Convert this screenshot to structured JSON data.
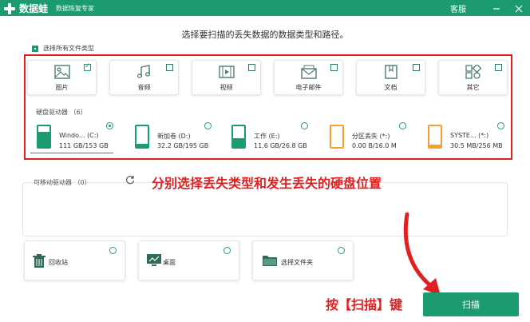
{
  "titlebar": {
    "brand": "数据蛙",
    "subtitle": "数据恢复专家",
    "service": "客服",
    "minimize_icon": "minimize-icon",
    "close_icon": "close-icon"
  },
  "heading": "选择要扫描的丢失数据的数据类型和路径。",
  "select_all_label": "选择所有文件类型",
  "file_types": [
    {
      "label": "图片",
      "icon": "image-icon",
      "checked": true
    },
    {
      "label": "音频",
      "icon": "audio-icon",
      "checked": false
    },
    {
      "label": "视频",
      "icon": "video-icon",
      "checked": false
    },
    {
      "label": "电子邮件",
      "icon": "email-icon",
      "checked": false
    },
    {
      "label": "文档",
      "icon": "document-icon",
      "checked": false
    },
    {
      "label": "其它",
      "icon": "other-icon",
      "checked": false
    }
  ],
  "hard_drives_label": "硬盘驱动器 （6）",
  "drives": [
    {
      "name": "Windo... (C:)",
      "size": "111 GB/153 GB",
      "selected": true,
      "color": "#1c9c6e",
      "fill": 0.73
    },
    {
      "name": "新加卷 (D:)",
      "size": "32.2 GB/195 GB",
      "selected": false,
      "color": "#1c9c6e",
      "fill": 0.17
    },
    {
      "name": "工作 (E:)",
      "size": "11.6 GB/26.8 GB",
      "selected": false,
      "color": "#1c9c6e",
      "fill": 0.43
    },
    {
      "name": "分区丢失 (*:)",
      "size": "0.00  B/16.0 M",
      "selected": false,
      "color": "#f5a030",
      "fill": 0.0
    },
    {
      "name": "SYSTE... (*:)",
      "size": "30.5 MB/256 MB",
      "selected": false,
      "color": "#f5a030",
      "fill": 0.12
    }
  ],
  "removable_label": "可移动驱动器 （0）",
  "annotation": "分别选择丢失类型和发生丢失的硬盘位置",
  "locations": [
    {
      "label": "回收站",
      "icon": "trash-icon"
    },
    {
      "label": "桌面",
      "icon": "desktop-icon"
    },
    {
      "label": "选择文件夹",
      "icon": "folder-icon"
    }
  ],
  "press_text": "按【扫描】键",
  "scan_button": "扫描",
  "colors": {
    "accent": "#1c9c6e",
    "annotation": "#e02020",
    "warning": "#f5a030"
  }
}
